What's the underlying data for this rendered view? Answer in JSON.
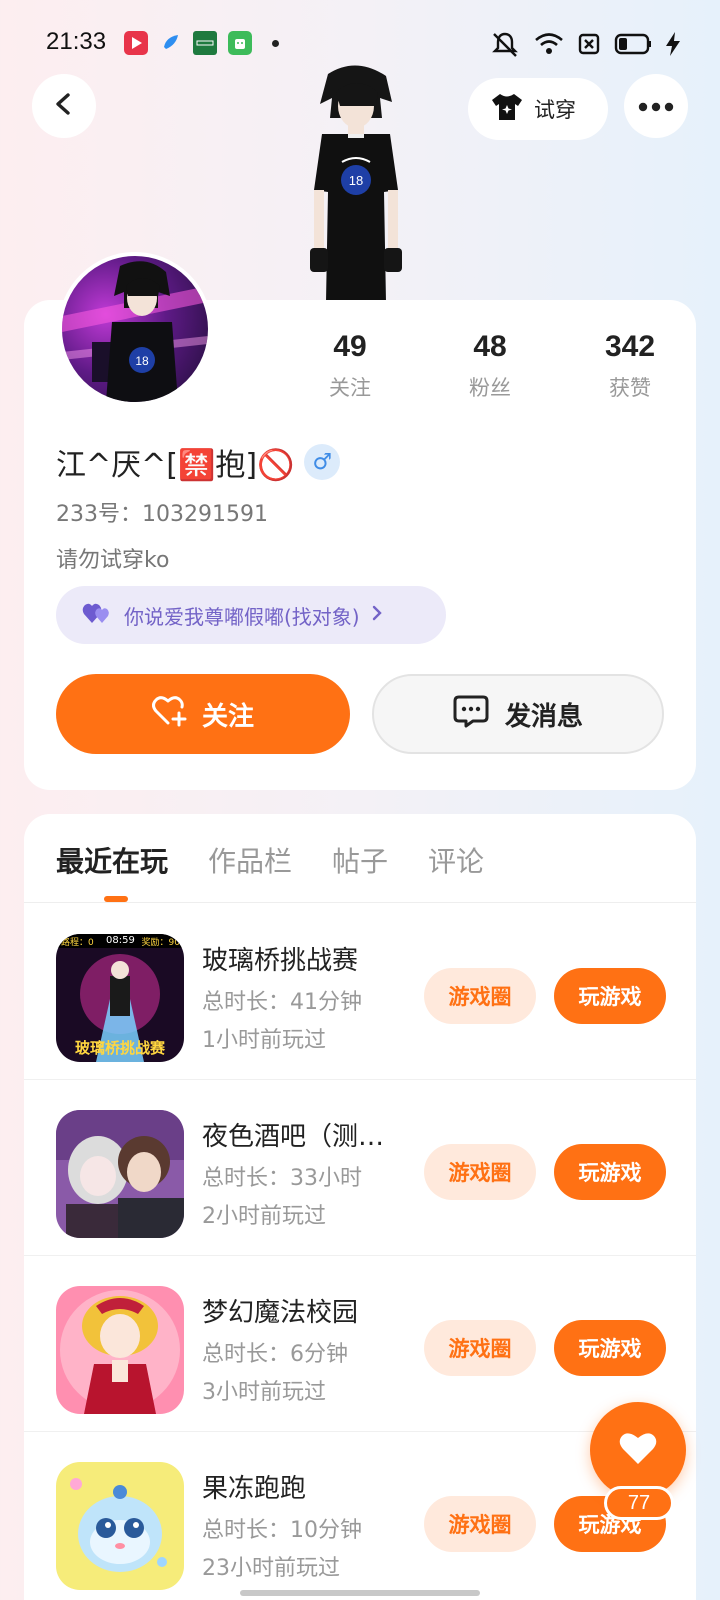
{
  "status_bar": {
    "time": "21:33",
    "icons": [
      "video-app-icon",
      "bird-app-icon",
      "green-app-icon",
      "android-app-icon",
      "mute-icon",
      "wifi-icon",
      "sim-icon",
      "battery-icon",
      "charging-icon"
    ]
  },
  "header": {
    "back_icon": "back-arrow-icon",
    "tryon_label": "试穿",
    "more_icon": "more-icon"
  },
  "profile": {
    "stats": [
      {
        "num": "49",
        "label": "关注"
      },
      {
        "num": "48",
        "label": "粉丝"
      },
      {
        "num": "342",
        "label": "获赞"
      }
    ],
    "username": "江^厌^[🈲抱]🚫",
    "gender": "♂",
    "uid": "233号：103291591",
    "bio": "请勿试穿ko",
    "tag": "你说爱我尊嘟假嘟(找对象)",
    "follow_label": "关注",
    "message_label": "发消息"
  },
  "tabs": [
    {
      "label": "最近在玩",
      "active": true
    },
    {
      "label": "作品栏",
      "active": false
    },
    {
      "label": "帖子",
      "active": false
    },
    {
      "label": "评论",
      "active": false
    }
  ],
  "games": [
    {
      "name": "玻璃桥挑战赛",
      "duration": "总时长：41分钟",
      "last_played": "1小时前玩过",
      "circle_label": "游戏圈",
      "play_label": "玩游戏",
      "icon_text": "玻璃桥挑战赛",
      "hud_left": "路程：0",
      "hud_time": "08:59",
      "hud_right": "奖励：90"
    },
    {
      "name": "夜色酒吧（测…",
      "duration": "总时长：33小时",
      "last_played": "2小时前玩过",
      "circle_label": "游戏圈",
      "play_label": "玩游戏"
    },
    {
      "name": "梦幻魔法校园",
      "duration": "总时长：6分钟",
      "last_played": "3小时前玩过",
      "circle_label": "游戏圈",
      "play_label": "玩游戏"
    },
    {
      "name": "果冻跑跑",
      "duration": "总时长：10分钟",
      "last_played": "23小时前玩过",
      "circle_label": "游戏圈",
      "play_label": "玩游戏"
    }
  ],
  "fab": {
    "count": "77"
  },
  "colors": {
    "accent": "#ff7114",
    "accent_light": "#ffe9dc",
    "tag_bg": "#eceaf9",
    "tag_text": "#7363c7"
  }
}
